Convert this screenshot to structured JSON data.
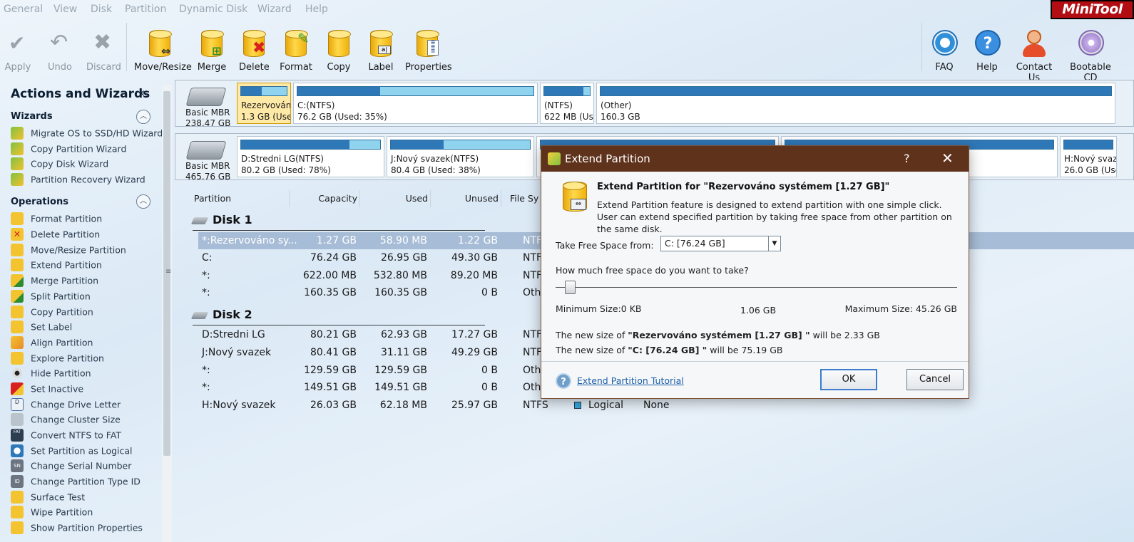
{
  "menu": [
    "General",
    "View",
    "Disk",
    "Partition",
    "Dynamic Disk",
    "Wizard",
    "Help"
  ],
  "brand": "MiniTool",
  "toolbar": {
    "apply": "Apply",
    "undo": "Undo",
    "discard": "Discard",
    "move_resize": "Move/Resize",
    "merge": "Merge",
    "delete": "Delete",
    "format": "Format",
    "copy": "Copy",
    "label": "Label",
    "properties": "Properties",
    "faq": "FAQ",
    "help": "Help",
    "contact": "Contact Us",
    "bootable": "Bootable CD"
  },
  "sidebar": {
    "title": "Actions and Wizards",
    "collapse_glyph": "«",
    "wizards_title": "Wizards",
    "wizards": [
      {
        "label": "Migrate OS to SSD/HD Wizard"
      },
      {
        "label": "Copy Partition Wizard"
      },
      {
        "label": "Copy Disk Wizard"
      },
      {
        "label": "Partition Recovery Wizard"
      }
    ],
    "operations_title": "Operations",
    "operations": [
      {
        "label": "Format Partition"
      },
      {
        "label": "Delete Partition"
      },
      {
        "label": "Move/Resize Partition"
      },
      {
        "label": "Extend Partition"
      },
      {
        "label": "Merge Partition"
      },
      {
        "label": "Split Partition"
      },
      {
        "label": "Copy Partition"
      },
      {
        "label": "Set Label"
      },
      {
        "label": "Align Partition"
      },
      {
        "label": "Explore Partition"
      },
      {
        "label": "Hide Partition"
      },
      {
        "label": "Set Inactive"
      },
      {
        "label": "Change Drive Letter"
      },
      {
        "label": "Change Cluster Size"
      },
      {
        "label": "Convert NTFS to FAT"
      },
      {
        "label": "Set Partition as Logical"
      },
      {
        "label": "Change Serial Number"
      },
      {
        "label": "Change Partition Type ID"
      },
      {
        "label": "Surface Test"
      },
      {
        "label": "Wipe Partition"
      },
      {
        "label": "Show Partition Properties"
      }
    ]
  },
  "diskmap": {
    "disk1": {
      "type": "Basic MBR",
      "size": "238.47 GB",
      "parts": [
        {
          "l1": "Rezervováno",
          "l2": "1.3 GB (Used",
          "used": 0.46
        },
        {
          "l1": "C:(NTFS)",
          "l2": "76.2 GB (Used: 35%)",
          "used": 0.35
        },
        {
          "l1": "(NTFS)",
          "l2": "622 MB (Use",
          "used": 0.86
        },
        {
          "l1": "(Other)",
          "l2": "160.3 GB",
          "used": 1.0
        }
      ]
    },
    "disk2": {
      "type": "Basic MBR",
      "size": "465.76 GB",
      "parts": [
        {
          "l1": "D:Stredni LG(NTFS)",
          "l2": "80.2 GB (Used: 78%)",
          "used": 0.78
        },
        {
          "l1": "J:Nový svazek(NTFS)",
          "l2": "80.4 GB (Used: 38%)",
          "used": 0.38
        },
        {
          "l1": "",
          "l2": "",
          "used": 1.0
        },
        {
          "l1": "",
          "l2": "",
          "used": 1.0
        },
        {
          "l1": "H:Nový svaz",
          "l2": "26.0 GB (Use",
          "used": 1.0
        }
      ]
    }
  },
  "list": {
    "headers": {
      "partition": "Partition",
      "capacity": "Capacity",
      "used": "Used",
      "unused": "Unused",
      "fs": "File Sy"
    },
    "disk1_label": "Disk 1",
    "disk2_label": "Disk 2",
    "disk1_rows": [
      {
        "name": "*:Rezervováno sy...",
        "capacity": "1.27 GB",
        "used": "58.90 MB",
        "unused": "1.22 GB",
        "fs": "NTF"
      },
      {
        "name": "C:",
        "capacity": "76.24 GB",
        "used": "26.95 GB",
        "unused": "49.30 GB",
        "fs": "NTF"
      },
      {
        "name": "*:",
        "capacity": "622.00 MB",
        "used": "532.80 MB",
        "unused": "89.20 MB",
        "fs": "NTF"
      },
      {
        "name": "*:",
        "capacity": "160.35 GB",
        "used": "160.35 GB",
        "unused": "0 B",
        "fs": "Oth"
      }
    ],
    "disk2_rows": [
      {
        "name": "D:Stredni LG",
        "capacity": "80.21 GB",
        "used": "62.93 GB",
        "unused": "17.27 GB",
        "fs": "NTF"
      },
      {
        "name": "J:Nový svazek",
        "capacity": "80.41 GB",
        "used": "31.11 GB",
        "unused": "49.29 GB",
        "fs": "NTF"
      },
      {
        "name": "*:",
        "capacity": "129.59 GB",
        "used": "129.59 GB",
        "unused": "0 B",
        "fs": "Oth"
      },
      {
        "name": "*:",
        "capacity": "149.51 GB",
        "used": "149.51 GB",
        "unused": "0 B",
        "fs": "Oth"
      }
    ],
    "last_row": {
      "name": "H:Nový svazek",
      "capacity": "26.03 GB",
      "used": "62.18 MB",
      "unused": "25.97 GB",
      "fs": "NTFS",
      "type": "Logical",
      "status": "None"
    }
  },
  "dialog": {
    "title": "Extend Partition",
    "help_glyph": "?",
    "close_glyph": "✕",
    "heading": "Extend Partition for \"Rezervováno systémem [1.27 GB]\"",
    "desc1": "Extend Partition feature is designed to extend partition with one simple click.",
    "desc2": "User can extend specified partition by taking free space from other partition on the same disk.",
    "take_from_label": "Take Free Space from:",
    "take_from_value": "C:  [76.24 GB]",
    "question": "How much free space do you want to take?",
    "min_label": "Minimum Size:0 KB",
    "current_value": "1.06 GB",
    "max_label": "Maximum Size: 45.26 GB",
    "slider_fraction": 0.023,
    "new_size_1_pre": "The new size of ",
    "new_size_1_name": "\"Rezervováno systémem [1.27 GB] \"",
    "new_size_1_post": " will be 2.33 GB",
    "new_size_2_pre": "The new size of ",
    "new_size_2_name": "\"C: [76.24 GB] \"",
    "new_size_2_post": " will be 75.19 GB",
    "tutorial_link": "Extend Partition Tutorial",
    "ok": "OK",
    "cancel": "Cancel"
  },
  "colors": {
    "accent": "#2f78b8",
    "dialog_title": "#5f321b",
    "selected_row": "#a7bcd6",
    "brand_red": "#b20d12"
  }
}
